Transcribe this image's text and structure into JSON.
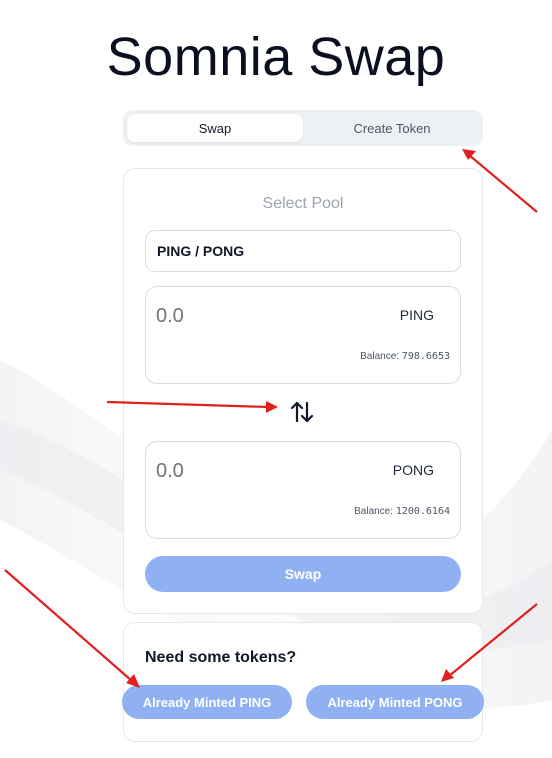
{
  "page": {
    "title": "Somnia Swap"
  },
  "tabs": [
    {
      "label": "Swap",
      "active": true
    },
    {
      "label": "Create Token",
      "active": false
    }
  ],
  "swap": {
    "section_label": "Select Pool",
    "pool": "PING / PONG",
    "from": {
      "placeholder": "0.0",
      "token": "PING",
      "balance_label": "Balance:",
      "balance_value": "798.6653"
    },
    "to": {
      "placeholder": "0.0",
      "token": "PONG",
      "balance_label": "Balance:",
      "balance_value": "1200.6164"
    },
    "direction_icon": "swap-vertical-arrows-icon",
    "button_label": "Swap"
  },
  "mint": {
    "heading": "Need some tokens?",
    "ping_button": "Already Minted PING",
    "pong_button": "Already Minted PONG"
  },
  "colors": {
    "accent": "#8fb0f2",
    "annotation_arrow": "#e0201c",
    "title": "#0b1020"
  }
}
